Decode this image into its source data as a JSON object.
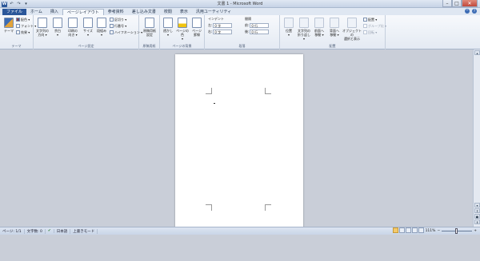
{
  "window": {
    "title": "文書 1 - Microsoft Word",
    "qat": [
      "W",
      "↶",
      "↷",
      "▾"
    ],
    "controls": {
      "minimize": "–",
      "maximize": "□",
      "close": "✕"
    }
  },
  "tabs": [
    {
      "label": "ファイル"
    },
    {
      "label": "ホーム"
    },
    {
      "label": "挿入"
    },
    {
      "label": "ページレイアウト"
    },
    {
      "label": "参考資料"
    },
    {
      "label": "差し込み文書"
    },
    {
      "label": "校閲"
    },
    {
      "label": "表示"
    },
    {
      "label": "汎用ユーティリティ"
    }
  ],
  "ribbon": {
    "theme": {
      "label": "テーマ",
      "themes_button": "テーマ",
      "colors": "配色 ▾",
      "fonts": "フォント ▾",
      "effects": "効果 ▾"
    },
    "page_setup": {
      "label": "ページ設定",
      "text_direction": "文字列の\n方向 ▾",
      "margins": "余白\n▾",
      "orientation": "印刷の\n向き ▾",
      "size": "サイズ\n▾",
      "columns": "段組み\n▾",
      "breaks": "区切り ▾",
      "line_numbers": "行番号 ▾",
      "hyphenation": "ハイフネーション ▾"
    },
    "manuscript": {
      "label": "原稿用紙",
      "settings": "原稿用紙\n設定"
    },
    "page_background": {
      "label": "ページの背景",
      "watermark": "透かし\n▾",
      "page_color": "ページの色\n▾",
      "page_borders": "ページ\n罫線"
    },
    "paragraph": {
      "label": "段落",
      "indent_label": "インデント",
      "spacing_label": "間隔",
      "left_label": "左:",
      "left_value": "0 字",
      "right_label": "右:",
      "right_value": "0 字",
      "before_label": "前:",
      "before_value": "0 行",
      "after_label": "後:",
      "after_value": "0 行"
    },
    "arrange": {
      "label": "配置",
      "position": "位置\n▾",
      "wrap_text": "文字列の\n折り返し ▾",
      "bring_forward": "前面へ\n移動 ▾",
      "send_backward": "背面へ\n移動 ▾",
      "selection_pane": "オブジェクトの\n選択と表示",
      "align": "配置 ▾",
      "group": "グループ化 ▾",
      "rotate": "回転 ▾"
    }
  },
  "statusbar": {
    "page": "ページ: 1/1",
    "words": "文字数: 0",
    "language": "日本語",
    "mode": "上書きモード",
    "zoom": "111%",
    "zoom_minus": "−",
    "zoom_plus": "+"
  },
  "scrollbar": {
    "up": "▴",
    "down": "▾",
    "prev": "⇞",
    "next": "⇟",
    "select": "●"
  }
}
